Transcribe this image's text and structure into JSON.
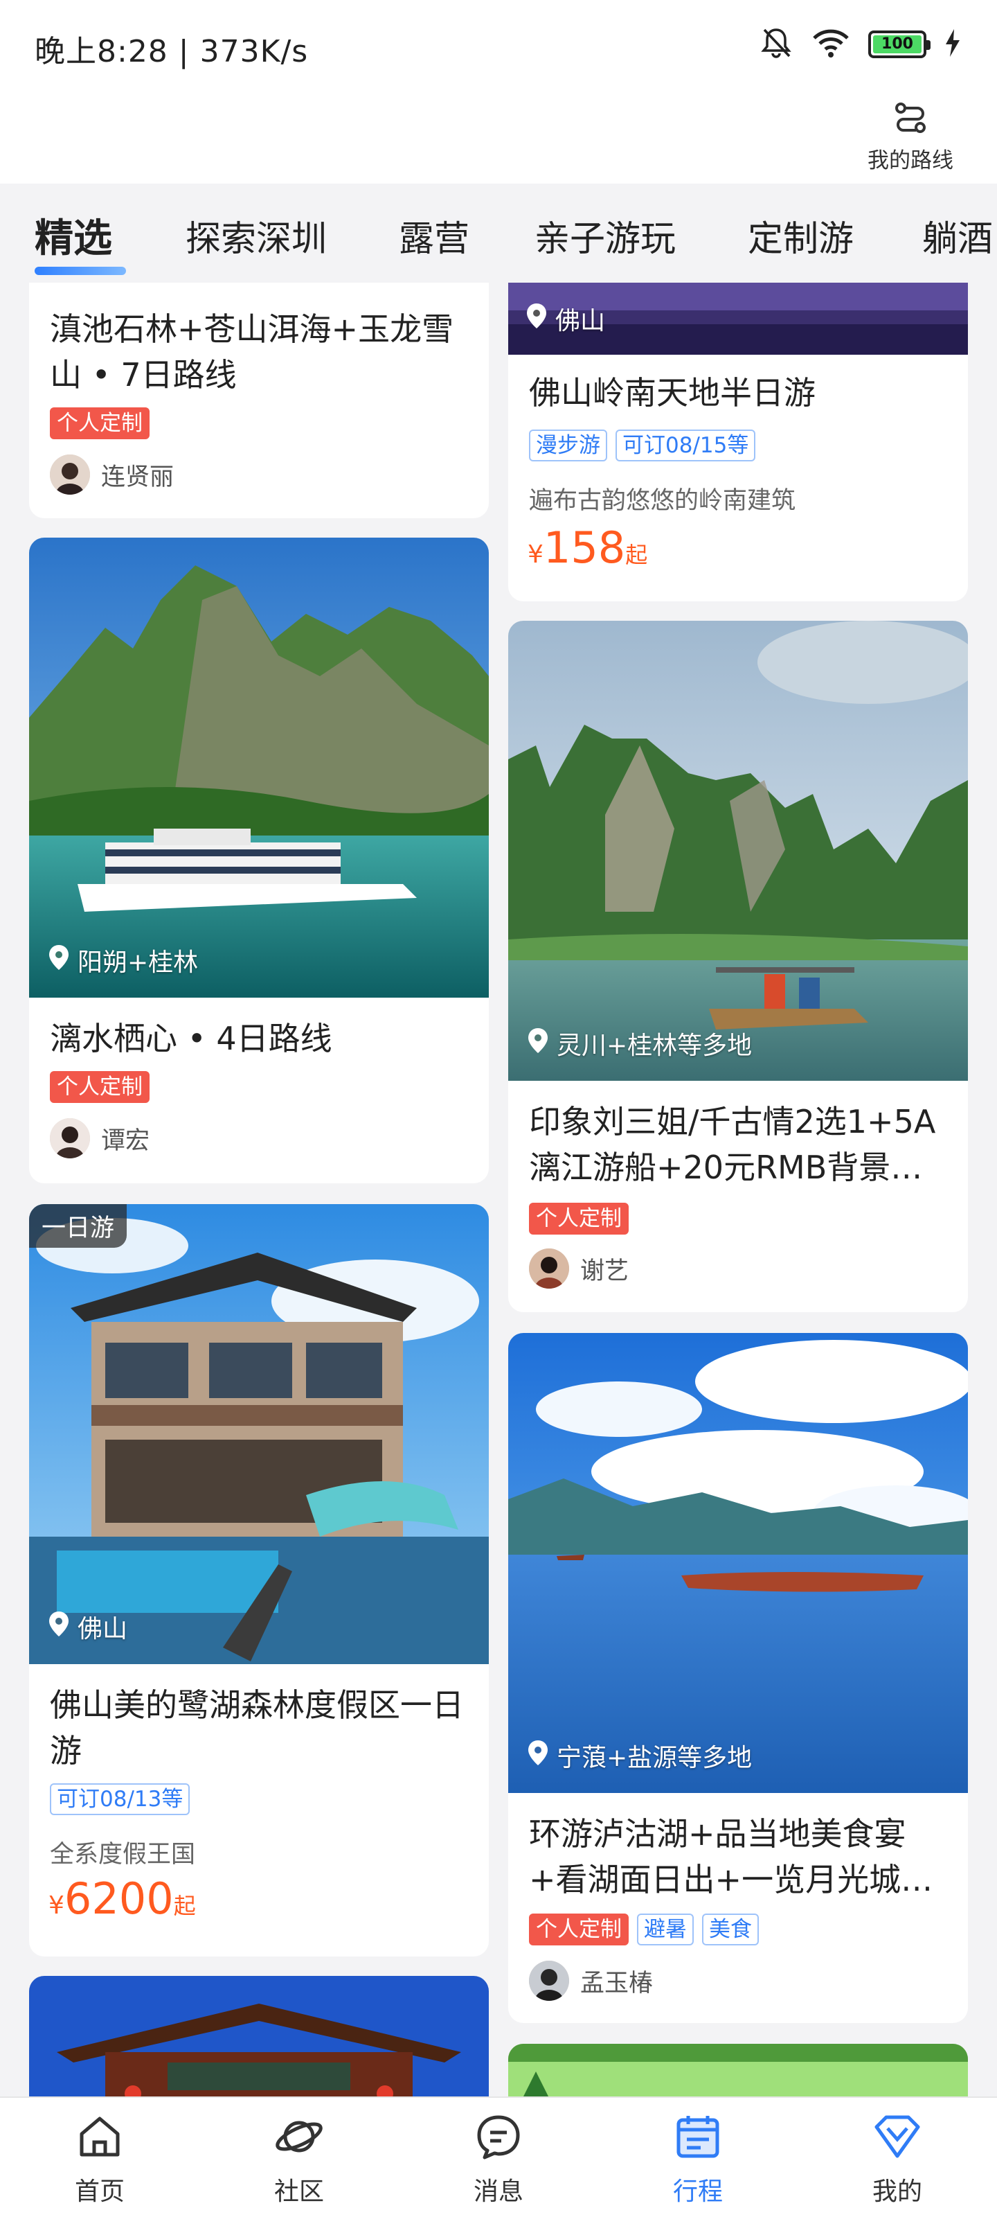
{
  "status_bar": {
    "time": "晚上8:28 | 373K/s",
    "battery": "100"
  },
  "header": {
    "route_label": "我的路线"
  },
  "tabs": [
    "精选",
    "探索深圳",
    "露营",
    "亲子游玩",
    "定制游",
    "躺酒"
  ],
  "cards": {
    "c1": {
      "title": "滇池石林+苍山洱海+玉龙雪山 • 7日路线",
      "tag": "个人定制",
      "author": "连贤丽"
    },
    "c2": {
      "location": "佛山",
      "title": "佛山岭南天地半日游",
      "tags": [
        "漫步游",
        "可订08/15等"
      ],
      "desc": "遍布古韵悠悠的岭南建筑",
      "price_symbol": "¥",
      "price": "158",
      "price_suffix": "起"
    },
    "c3": {
      "location": "阳朔+桂林",
      "title": "漓水栖心 • 4日路线",
      "tag": "个人定制",
      "author": "谭宏"
    },
    "c4": {
      "location": "灵川+桂林等多地",
      "title": "印象刘三姐/千古情2选1+5A漓江游船+20元RMB背景…",
      "tag": "个人定制",
      "author": "谢艺"
    },
    "c5": {
      "badge": "一日游",
      "location": "佛山",
      "title": "佛山美的鹭湖森林度假区一日游",
      "tags": [
        "可订08/13等"
      ],
      "desc": "全系度假王国",
      "price_symbol": "¥",
      "price": "6200",
      "price_suffix": "起"
    },
    "c6": {
      "location": "宁蒗+盐源等多地",
      "title": "环游泸沽湖+品当地美食宴+看湖面日出+一览月光城…",
      "tags": [
        "个人定制",
        "避暑",
        "美食"
      ],
      "author": "孟玉椿"
    }
  },
  "bottom_nav": [
    "首页",
    "社区",
    "消息",
    "行程",
    "我的"
  ],
  "colors": {
    "accent": "#2f7cf6",
    "price": "#ff5a1f",
    "tag_red": "#f2574a"
  }
}
